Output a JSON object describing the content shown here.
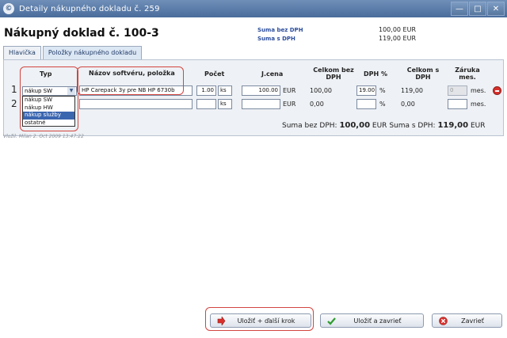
{
  "window": {
    "title": "Detaily nákupného dokladu č. 259"
  },
  "header": {
    "doc_title": "Nákupný doklad č. 100-3",
    "sum_bez_dph_label": "Suma bez DPH",
    "sum_bez_dph_value": "100,00 EUR",
    "sum_s_dph_label": "Suma s DPH",
    "sum_s_dph_value": "119,00 EUR"
  },
  "tabs": [
    {
      "label": "Hlavička"
    },
    {
      "label": "Položky nákupného dokladu"
    }
  ],
  "columns": {
    "typ": "Typ",
    "nazov": "Názov softvéru, položka",
    "pocet": "Počet",
    "jcena": "J.cena",
    "celkom_bez": "Celkom bez DPH",
    "dph": "DPH %",
    "celkom_s": "Celkom s DPH",
    "zaruka": "Záruka mes."
  },
  "rows": [
    {
      "num": "1",
      "typ": "nákup SW",
      "nazov": "HP Carepack 3y pre NB HP 6730b",
      "pocet": "1.00",
      "unit": "ks",
      "jcena": "100.00",
      "currency": "EUR",
      "celkom_bez": "100,00",
      "dph": "19.00",
      "pct": "%",
      "celkom_s": "119,00",
      "zaruka": "0",
      "mes": "mes."
    },
    {
      "num": "2",
      "typ": "",
      "nazov": "",
      "pocet": "",
      "unit": "ks",
      "jcena": "",
      "currency": "EUR",
      "celkom_bez": "0,00",
      "dph": "",
      "pct": "%",
      "celkom_s": "0,00",
      "zaruka": "",
      "mes": "mes."
    }
  ],
  "dropdown": {
    "options": [
      "nákup SW",
      "nákup HW",
      "nákup služby",
      "ostatné"
    ],
    "highlighted": "nákup služby"
  },
  "totals": {
    "bez_label": "Suma bez DPH:",
    "bez_value": "100,00",
    "bez_cur": "EUR",
    "s_label": "Suma s DPH:",
    "s_value": "119,00",
    "s_cur": "EUR"
  },
  "meta": {
    "text": "Vložil: Milan      2. Oct 2009 13:47:22"
  },
  "buttons": {
    "save_next": "Uložiť + ďalší krok",
    "save_close": "Uložiť a zavrieť",
    "close": "Zavrieť"
  },
  "colors": {
    "titlebar": "#4a6c9c",
    "highlight": "#d2453f",
    "selected": "#3a66b0"
  }
}
